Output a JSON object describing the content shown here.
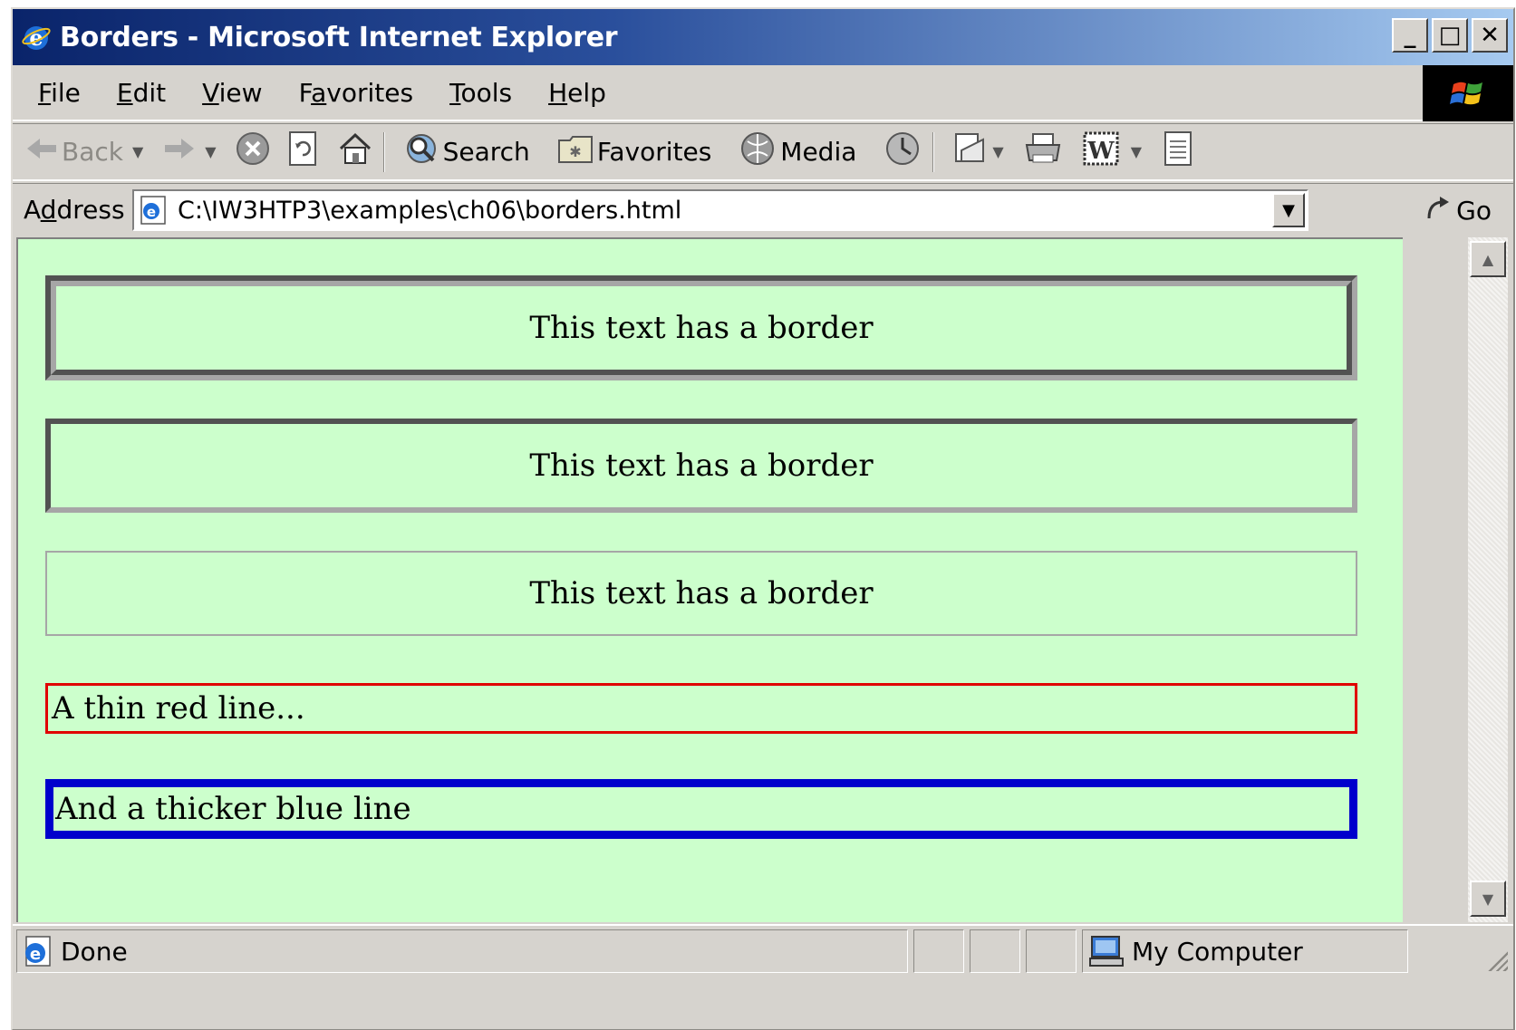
{
  "window": {
    "title": "Borders - Microsoft Internet Explorer",
    "controls": {
      "minimize": "_",
      "maximize": "□",
      "close": "✕"
    }
  },
  "menu": {
    "items": [
      {
        "pre": "",
        "key": "F",
        "post": "ile"
      },
      {
        "pre": "",
        "key": "E",
        "post": "dit"
      },
      {
        "pre": "",
        "key": "V",
        "post": "iew"
      },
      {
        "pre": "F",
        "key": "a",
        "post": "vorites"
      },
      {
        "pre": "",
        "key": "T",
        "post": "ools"
      },
      {
        "pre": "",
        "key": "H",
        "post": "elp"
      }
    ]
  },
  "toolbar": {
    "back": "Back",
    "search": "Search",
    "favorites": "Favorites",
    "media": "Media"
  },
  "address": {
    "label_pre": "A",
    "label_key": "d",
    "label_post": "dress",
    "url": "C:\\IW3HTP3\\examples\\ch06\\borders.html",
    "go": "Go"
  },
  "page": {
    "boxes": [
      {
        "text": "This text has a border"
      },
      {
        "text": "This text has a border"
      },
      {
        "text": "This text has a border"
      },
      {
        "text": "A thin red line..."
      },
      {
        "text": "And a thicker blue line"
      }
    ]
  },
  "status": {
    "text": "Done",
    "zone": "My Computer"
  },
  "colors": {
    "content_bg": "#ccffcc",
    "red_line": "#e00000",
    "blue_line": "#0000cc",
    "title_gradient_start": "#0a246a",
    "title_gradient_end": "#a6caf0"
  }
}
